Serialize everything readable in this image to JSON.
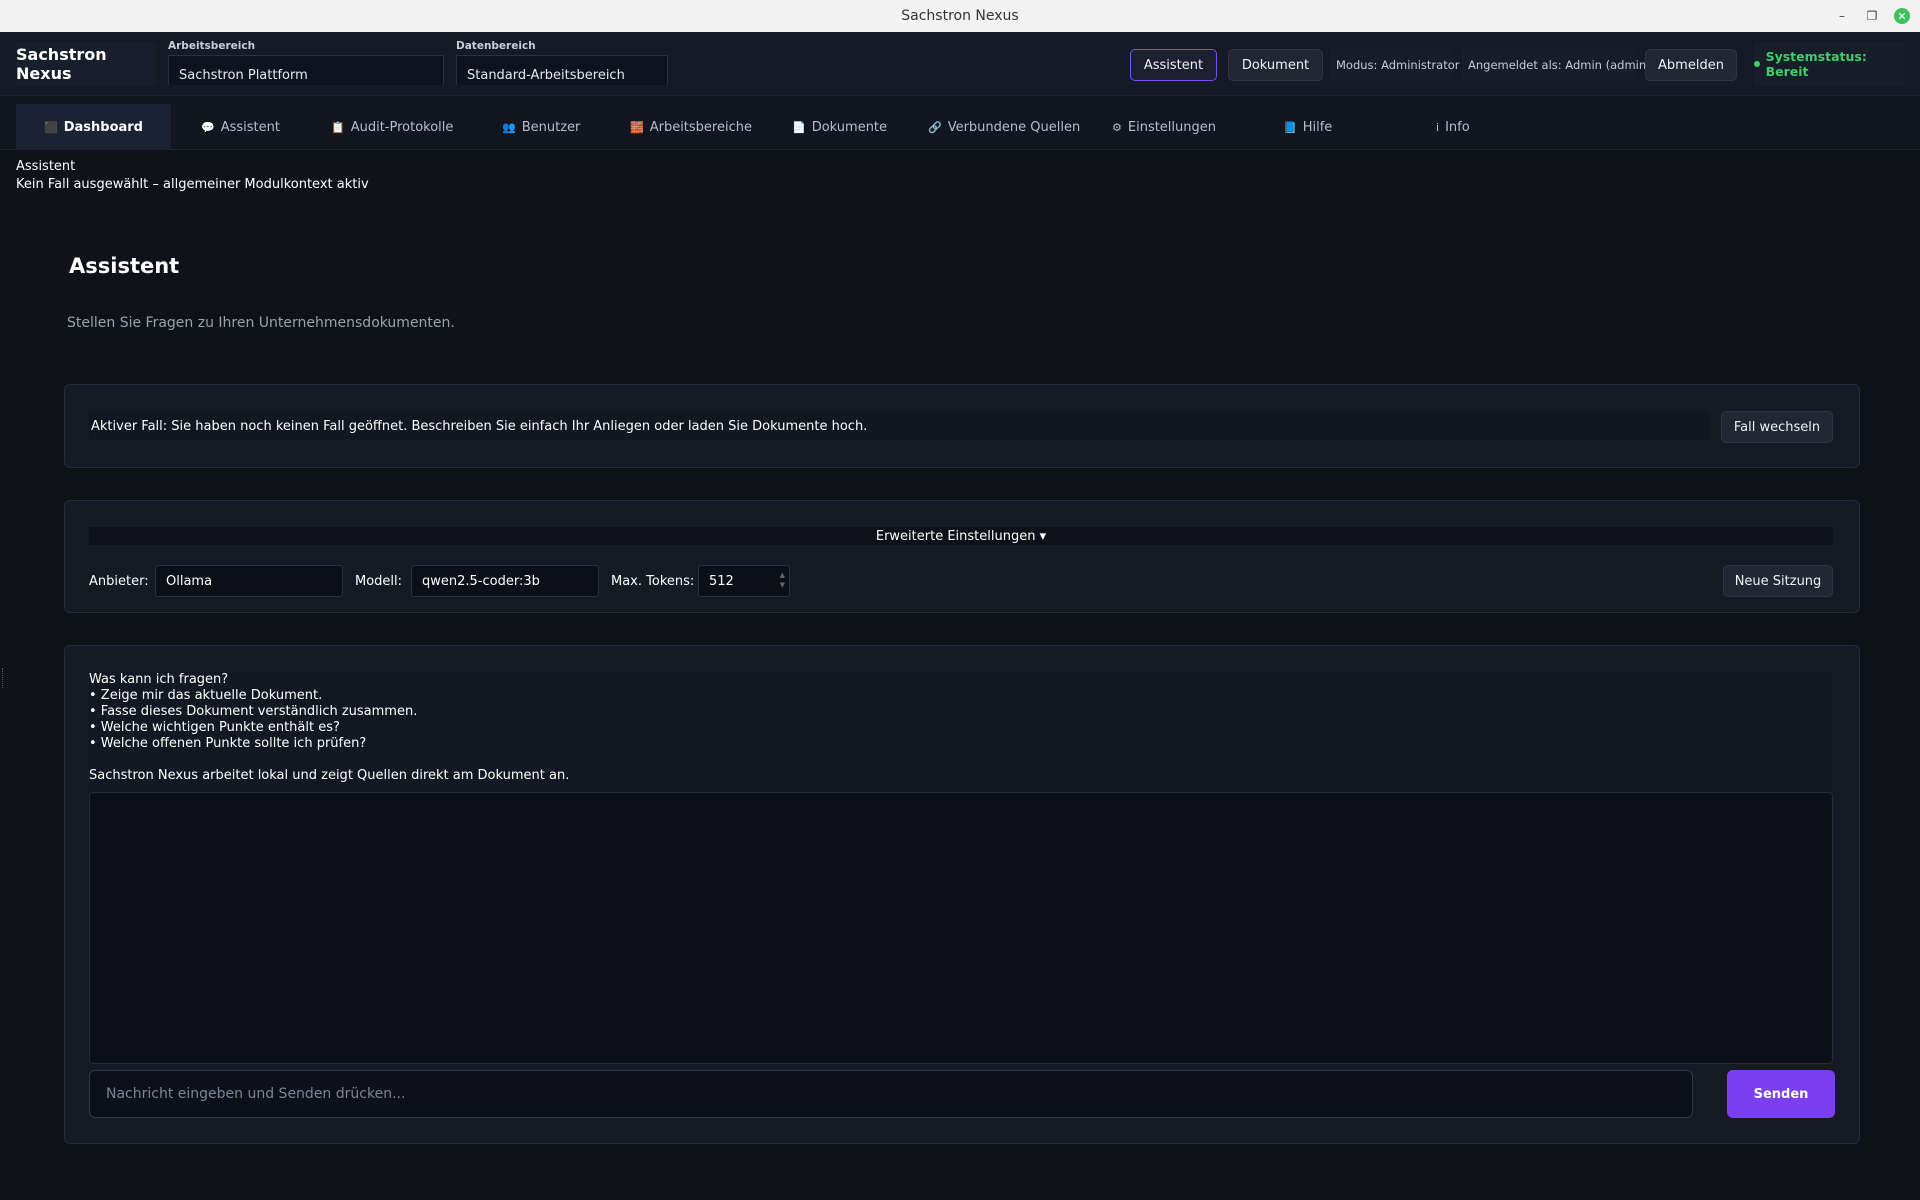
{
  "window": {
    "title": "Sachstron Nexus",
    "minimize": "–",
    "maximize": "❐",
    "close": "✕"
  },
  "header": {
    "brand": "Sachstron Nexus",
    "workspace": {
      "label": "Arbeitsbereich",
      "value": "Sachstron Plattform"
    },
    "data_scope": {
      "label": "Datenbereich",
      "value": "Standard-Arbeitsbereich"
    },
    "assistant_button": "Assistent",
    "document_button": "Dokument",
    "mode": "Modus: Administrator",
    "logged_in": "Angemeldet als: Admin (admin)",
    "logout_button": "Abmelden",
    "status": "Systemstatus: Bereit",
    "status_color": "#3ecf6a"
  },
  "tabs": [
    {
      "label": "Dashboard",
      "icon": "⬛",
      "icon_name": "dashboard-icon"
    },
    {
      "label": "Assistent",
      "icon": "💬",
      "icon_name": "chat-icon"
    },
    {
      "label": "Audit-Protokolle",
      "icon": "📋",
      "icon_name": "clipboard-icon"
    },
    {
      "label": "Benutzer",
      "icon": "👥",
      "icon_name": "users-icon"
    },
    {
      "label": "Arbeitsbereiche",
      "icon": "🧱",
      "icon_name": "workspaces-icon"
    },
    {
      "label": "Dokumente",
      "icon": "📄",
      "icon_name": "document-icon"
    },
    {
      "label": "Verbundene Quellen",
      "icon": "🔗",
      "icon_name": "link-icon"
    },
    {
      "label": "Einstellungen",
      "icon": "⚙",
      "icon_name": "gear-icon"
    },
    {
      "label": "Hilfe",
      "icon": "📘",
      "icon_name": "help-book-icon"
    },
    {
      "label": "Info",
      "icon": "i",
      "icon_name": "info-icon"
    }
  ],
  "context": {
    "module": "Assistent",
    "case_info": "Kein Fall ausgewählt – allgemeiner Modulkontext aktiv"
  },
  "page": {
    "title": "Assistent",
    "subtitle": "Stellen Sie Fragen zu Ihren Unternehmensdokumenten."
  },
  "case_panel": {
    "text": "Aktiver Fall: Sie haben noch keinen Fall geöffnet. Beschreiben Sie einfach Ihr Anliegen oder laden Sie Dokumente hoch.",
    "switch_button": "Fall wechseln"
  },
  "settings_panel": {
    "toggle": "Erweiterte Einstellungen ▾",
    "provider_label": "Anbieter:",
    "provider_value": "Ollama",
    "model_label": "Modell:",
    "model_value": "qwen2.5-coder:3b",
    "tokens_label": "Max. Tokens:",
    "tokens_value": "512",
    "new_session_button": "Neue Sitzung"
  },
  "chat_panel": {
    "intro_lines": [
      "Was kann ich fragen?",
      "• Zeige mir das aktuelle Dokument.",
      "• Fasse dieses Dokument verständlich zusammen.",
      "• Welche wichtigen Punkte enthält es?",
      "• Welche offenen Punkte sollte ich prüfen?",
      "",
      "Sachstron Nexus arbeitet lokal und zeigt Quellen direkt am Dokument an."
    ],
    "input_placeholder": "Nachricht eingeben und Senden drücken...",
    "send_button": "Senden",
    "accent_color": "#7b3ff0"
  }
}
